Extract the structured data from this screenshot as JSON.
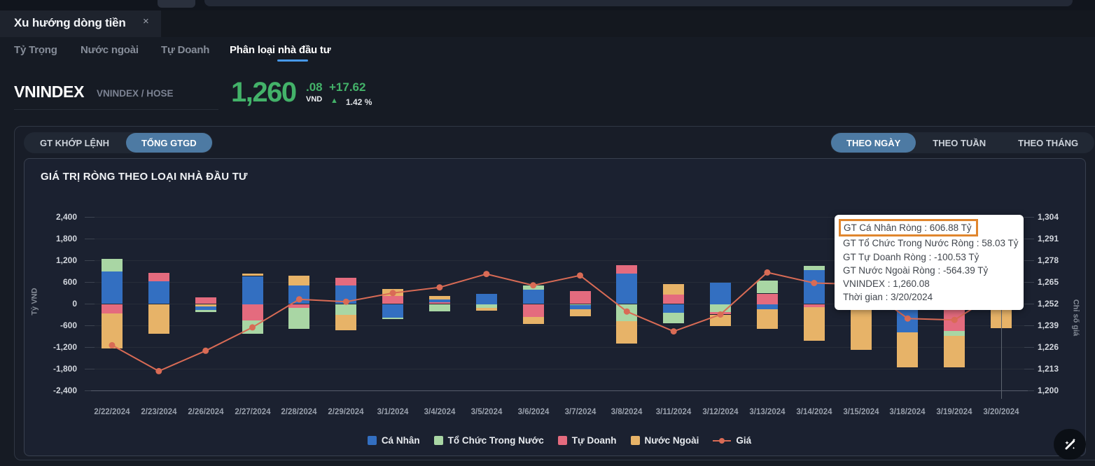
{
  "doc_tab": {
    "title": "Xu hướng dòng tiền",
    "close_icon": "×"
  },
  "subtabs": [
    {
      "label": "Tỷ Trọng",
      "active": false
    },
    {
      "label": "Nước ngoài",
      "active": false
    },
    {
      "label": "Tự Doanh",
      "active": false
    },
    {
      "label": "Phân loại nhà đầu tư",
      "active": true
    }
  ],
  "index": {
    "symbol": "VNINDEX",
    "exchange": "VNINDEX / HOSE",
    "price_int": "1,260",
    "price_dec": ".08",
    "currency": "VND",
    "change": "+17.62",
    "up_arrow": "▲",
    "change_pct": "1.42 %"
  },
  "toolbar": {
    "left": [
      {
        "label": "GT KHỚP LỆNH",
        "active": false
      },
      {
        "label": "TỔNG GTGD",
        "active": true
      }
    ],
    "right": [
      {
        "label": "THEO NGÀY",
        "active": true
      },
      {
        "label": "THEO TUẦN",
        "active": false
      },
      {
        "label": "THEO THÁNG",
        "active": false
      }
    ]
  },
  "tooltip": {
    "lines": [
      {
        "text": "GT Cá Nhân Ròng : 606.88 Tỷ",
        "highlighted": true
      },
      {
        "text": "GT Tổ Chức Trong Nước Ròng : 58.03 Tỷ",
        "highlighted": false
      },
      {
        "text": "GT Tự Doanh Ròng : -100.53 Tỷ",
        "highlighted": false
      },
      {
        "text": "GT Nước Ngoài Ròng : -564.39 Tỷ",
        "highlighted": false
      },
      {
        "text": "VNINDEX : 1,260.08",
        "highlighted": false
      },
      {
        "text": "Thời gian : 3/20/2024",
        "highlighted": false
      }
    ]
  },
  "chart_data": {
    "type": "bar",
    "subtype": "stacked-bar + line overlay",
    "title": "GIÁ TRỊ RÒNG THEO LOẠI NHÀ ĐẦU TƯ",
    "left_axis": {
      "label": "Tỷ VND",
      "min": -2400,
      "max": 2400,
      "step": 600
    },
    "right_axis": {
      "label": "Chỉ số giá",
      "min": 1200,
      "max": 1304,
      "step": 13
    },
    "grid": true,
    "legend_position": "bottom-center",
    "series": [
      {
        "key": "ca_nhan",
        "name": "Cá Nhân",
        "color": "#336fc1",
        "kind": "bar"
      },
      {
        "key": "to_chuc",
        "name": "Tổ Chức Trong Nước",
        "color": "#a9d6a4",
        "kind": "bar"
      },
      {
        "key": "tu_doanh",
        "name": "Tự Doanh",
        "color": "#e46b7e",
        "kind": "bar"
      },
      {
        "key": "nuoc_ngoai",
        "name": "Nước Ngoài",
        "color": "#e7b368",
        "kind": "bar"
      },
      {
        "key": "gia",
        "name": "Giá",
        "color": "#d96b55",
        "kind": "line"
      }
    ],
    "categories": [
      "2/22/2024",
      "2/23/2024",
      "2/26/2024",
      "2/27/2024",
      "2/28/2024",
      "2/29/2024",
      "3/1/2024",
      "3/4/2024",
      "3/5/2024",
      "3/6/2024",
      "3/7/2024",
      "3/8/2024",
      "3/11/2024",
      "3/12/2024",
      "3/13/2024",
      "3/14/2024",
      "3/15/2024",
      "3/18/2024",
      "3/19/2024",
      "3/20/2024"
    ],
    "bars": [
      {
        "date": "2/22/2024",
        "segments": [
          [
            "to_chuc",
            360
          ],
          [
            "ca_nhan",
            895
          ],
          [
            "tu_doanh",
            -270
          ],
          [
            "nuoc_ngoai",
            -965
          ]
        ]
      },
      {
        "date": "2/23/2024",
        "segments": [
          [
            "tu_doanh",
            240
          ],
          [
            "ca_nhan",
            625
          ],
          [
            "nuoc_ngoai",
            -830
          ]
        ]
      },
      {
        "date": "2/26/2024",
        "segments": [
          [
            "tu_doanh",
            180
          ],
          [
            "nuoc_ngoai",
            -65
          ],
          [
            "ca_nhan",
            -95
          ],
          [
            "to_chuc",
            -65
          ]
        ]
      },
      {
        "date": "2/27/2024",
        "segments": [
          [
            "nuoc_ngoai",
            60
          ],
          [
            "ca_nhan",
            775
          ],
          [
            "tu_doanh",
            -445
          ],
          [
            "to_chuc",
            -385
          ]
        ]
      },
      {
        "date": "2/28/2024",
        "segments": [
          [
            "nuoc_ngoai",
            270
          ],
          [
            "ca_nhan",
            520
          ],
          [
            "tu_doanh",
            -110
          ],
          [
            "to_chuc",
            -575
          ]
        ]
      },
      {
        "date": "2/29/2024",
        "segments": [
          [
            "tu_doanh",
            200
          ],
          [
            "ca_nhan",
            520
          ],
          [
            "to_chuc",
            -290
          ],
          [
            "nuoc_ngoai",
            -430
          ]
        ]
      },
      {
        "date": "3/1/2024",
        "segments": [
          [
            "nuoc_ngoai",
            195
          ],
          [
            "tu_doanh",
            230
          ],
          [
            "ca_nhan",
            -375
          ],
          [
            "to_chuc",
            -40
          ]
        ]
      },
      {
        "date": "3/4/2024",
        "segments": [
          [
            "nuoc_ngoai",
            110
          ],
          [
            "ca_nhan",
            80
          ],
          [
            "tu_doanh",
            40
          ],
          [
            "to_chuc",
            -195
          ]
        ]
      },
      {
        "date": "3/5/2024",
        "segments": [
          [
            "ca_nhan",
            280
          ],
          [
            "to_chuc",
            -100
          ],
          [
            "nuoc_ngoai",
            -90
          ]
        ]
      },
      {
        "date": "3/6/2024",
        "segments": [
          [
            "to_chuc",
            130
          ],
          [
            "ca_nhan",
            390
          ],
          [
            "tu_doanh",
            -355
          ],
          [
            "nuoc_ngoai",
            -195
          ]
        ]
      },
      {
        "date": "3/7/2024",
        "segments": [
          [
            "tu_doanh",
            355
          ],
          [
            "to_chuc",
            -30
          ],
          [
            "ca_nhan",
            -110
          ],
          [
            "nuoc_ngoai",
            -195
          ]
        ]
      },
      {
        "date": "3/8/2024",
        "segments": [
          [
            "tu_doanh",
            230
          ],
          [
            "ca_nhan",
            840
          ],
          [
            "to_chuc",
            -475
          ],
          [
            "nuoc_ngoai",
            -620
          ]
        ]
      },
      {
        "date": "3/11/2024",
        "segments": [
          [
            "nuoc_ngoai",
            280
          ],
          [
            "tu_doanh",
            270
          ],
          [
            "ca_nhan",
            -240
          ],
          [
            "to_chuc",
            -290
          ]
        ]
      },
      {
        "date": "3/12/2024",
        "segments": [
          [
            "ca_nhan",
            590
          ],
          [
            "to_chuc",
            -230
          ],
          [
            "tu_doanh",
            -60
          ],
          [
            "nuoc_ngoai",
            -310
          ]
        ]
      },
      {
        "date": "3/13/2024",
        "segments": [
          [
            "to_chuc",
            355
          ],
          [
            "tu_doanh",
            290
          ],
          [
            "ca_nhan",
            -145
          ],
          [
            "nuoc_ngoai",
            -550
          ]
        ]
      },
      {
        "date": "3/14/2024",
        "segments": [
          [
            "to_chuc",
            130
          ],
          [
            "ca_nhan",
            935
          ],
          [
            "tu_doanh",
            -85
          ],
          [
            "nuoc_ngoai",
            -925
          ]
        ]
      },
      {
        "date": "3/15/2024",
        "segments": [
          [
            "ca_nhan",
            130
          ],
          [
            "nuoc_ngoai",
            -1270
          ]
        ]
      },
      {
        "date": "3/18/2024",
        "segments": [
          [
            "tu_doanh",
            200
          ],
          [
            "ca_nhan",
            -790
          ],
          [
            "nuoc_ngoai",
            -960
          ]
        ]
      },
      {
        "date": "3/19/2024",
        "segments": [
          [
            "ca_nhan",
            180
          ],
          [
            "tu_doanh",
            -745
          ],
          [
            "to_chuc",
            -135
          ],
          [
            "nuoc_ngoai",
            -870
          ]
        ]
      },
      {
        "date": "3/20/2024",
        "segments": [
          [
            "ca_nhan",
            606.88
          ],
          [
            "to_chuc",
            58.03
          ],
          [
            "tu_doanh",
            -100.53
          ],
          [
            "nuoc_ngoai",
            -564.39
          ]
        ]
      }
    ],
    "line": {
      "name": "Giá",
      "values": [
        1227.3,
        1211.8,
        1224.0,
        1238.0,
        1254.8,
        1253.4,
        1258.6,
        1262.0,
        1270.0,
        1263.2,
        1269.1,
        1247.5,
        1235.6,
        1245.7,
        1270.9,
        1264.6,
        1263.8,
        1243.3,
        1242.5,
        1260.08
      ]
    },
    "crosshair_category": "3/20/2024"
  },
  "colors": {
    "accent_blue": "#4d7aa3",
    "underline_blue": "#4798e8",
    "price_green": "#43b269",
    "tooltip_highlight": "#e0862e"
  },
  "icons": {
    "wand_button": "magic-wand-icon"
  }
}
